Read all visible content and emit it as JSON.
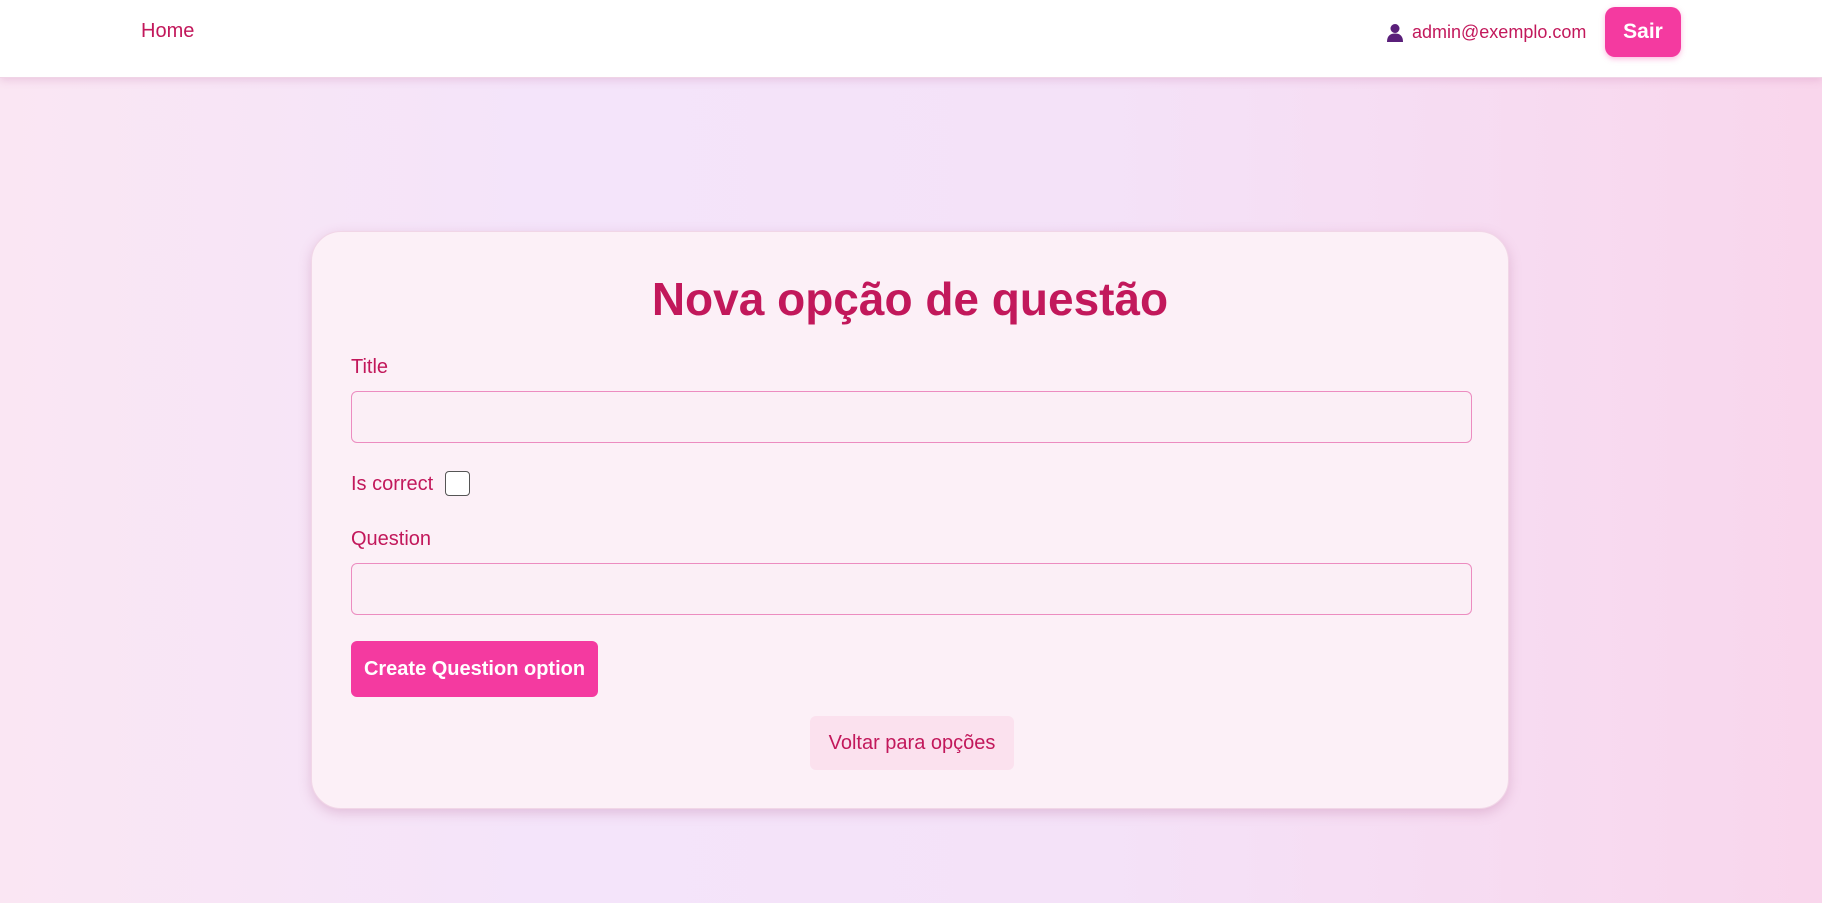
{
  "nav": {
    "home_label": "Home",
    "user_email": "admin@exemplo.com",
    "logout_label": "Sair"
  },
  "form": {
    "title": "Nova opção de questão",
    "title_label": "Title",
    "title_value": "",
    "is_correct_label": "Is correct",
    "is_correct_checked": false,
    "question_label": "Question",
    "question_value": "",
    "submit_label": "Create Question option",
    "back_label": "Voltar para opções"
  },
  "colors": {
    "accent": "#f43aa0",
    "text_primary": "#c2185b",
    "card_background": "#fcf0f7"
  },
  "icons": {
    "user": "user-icon"
  }
}
